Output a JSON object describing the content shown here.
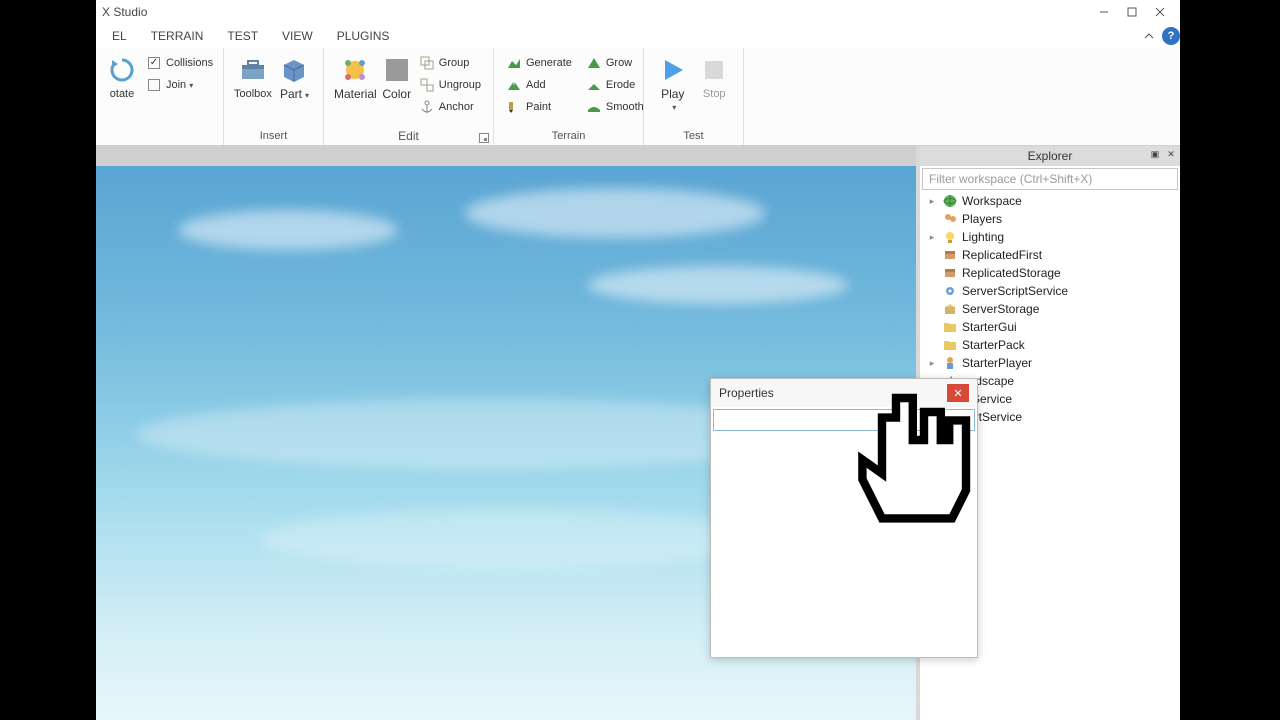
{
  "window": {
    "title": "X Studio"
  },
  "tabs": {
    "items": [
      "EL",
      "TERRAIN",
      "TEST",
      "VIEW",
      "PLUGINS"
    ]
  },
  "ribbon": {
    "g0": {
      "rotate": "otate",
      "collisions": "Collisions",
      "join": "Join"
    },
    "insert": {
      "label": "Insert",
      "toolbox": "Toolbox",
      "part": "Part"
    },
    "edit": {
      "label": "Edit",
      "material": "Material",
      "color": "Color",
      "group": "Group",
      "ungroup": "Ungroup",
      "anchor": "Anchor"
    },
    "terrain": {
      "label": "Terrain",
      "generate": "Generate",
      "add": "Add",
      "paint": "Paint",
      "grow": "Grow",
      "erode": "Erode",
      "smooth": "Smooth"
    },
    "test": {
      "label": "Test",
      "play": "Play",
      "stop": "Stop"
    }
  },
  "explorer": {
    "title": "Explorer",
    "filter_placeholder": "Filter workspace (Ctrl+Shift+X)",
    "items": [
      {
        "expand": true,
        "icon": "globe",
        "label": "Workspace"
      },
      {
        "expand": false,
        "icon": "players",
        "label": "Players"
      },
      {
        "expand": true,
        "icon": "light",
        "label": "Lighting"
      },
      {
        "expand": false,
        "icon": "repl",
        "label": "ReplicatedFirst"
      },
      {
        "expand": false,
        "icon": "repl",
        "label": "ReplicatedStorage"
      },
      {
        "expand": false,
        "icon": "gear",
        "label": "ServerScriptService"
      },
      {
        "expand": false,
        "icon": "store",
        "label": "ServerStorage"
      },
      {
        "expand": false,
        "icon": "folder",
        "label": "StarterGui"
      },
      {
        "expand": false,
        "icon": "folder",
        "label": "StarterPack"
      },
      {
        "expand": true,
        "icon": "player",
        "label": "StarterPlayer"
      },
      {
        "expand": false,
        "icon": "sound",
        "label": "undscape"
      },
      {
        "expand": false,
        "icon": "http",
        "label": "tpService"
      },
      {
        "expand": false,
        "icon": "insert",
        "label": "sertService"
      }
    ]
  },
  "properties": {
    "title": "Properties"
  }
}
